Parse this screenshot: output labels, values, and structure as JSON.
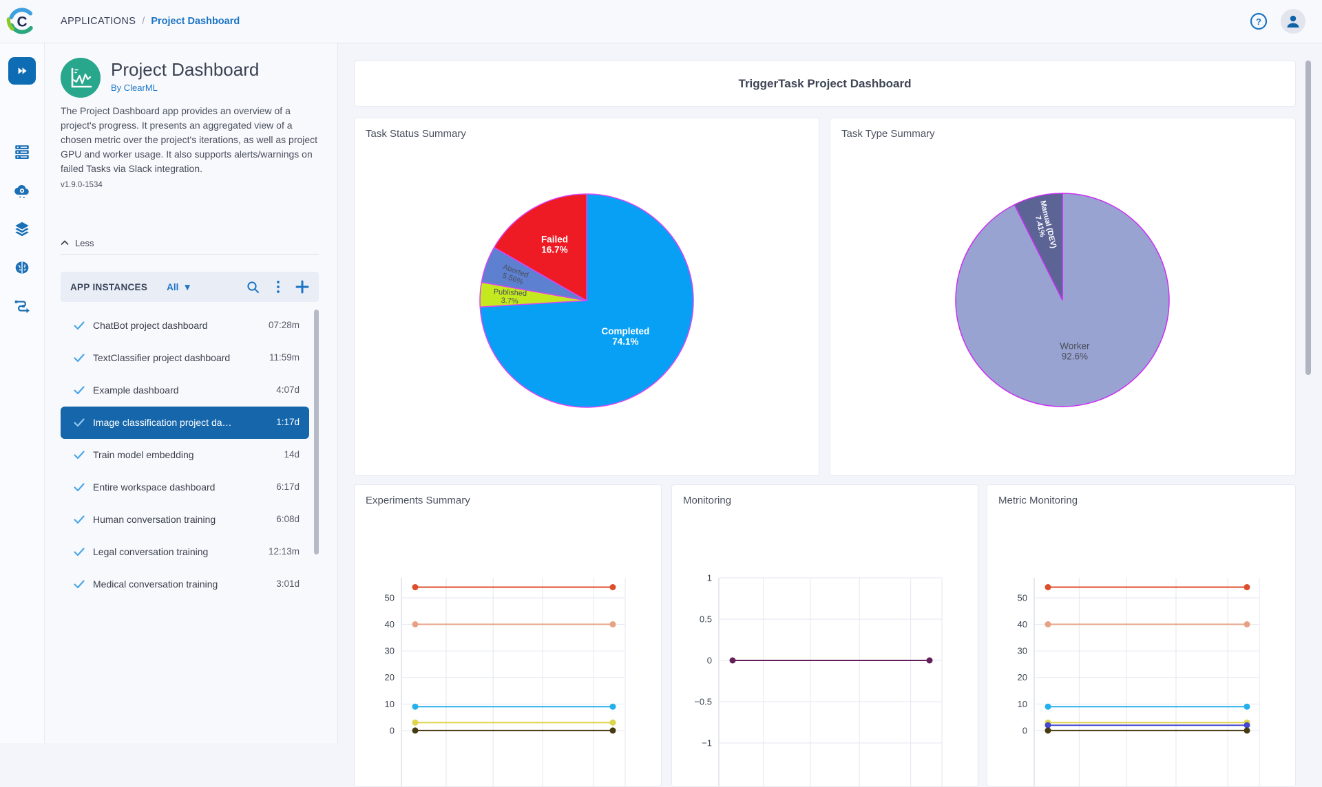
{
  "topbar": {
    "breadcrumb_root": "APPLICATIONS",
    "breadcrumb_separator": "/",
    "breadcrumb_current": "Project Dashboard",
    "help_glyph": "?"
  },
  "rail": {
    "items": [
      "applications",
      "workers-queues",
      "cloud-autoscalers",
      "datasets",
      "models",
      "pipelines"
    ],
    "accent_color": "#1a6fb5",
    "active_tile_color": "#0e6cb4"
  },
  "app_panel": {
    "title": "Project Dashboard",
    "byline": "By ClearML",
    "description": "The Project Dashboard app provides an overview of a project's progress. It presents an aggregated view of a chosen metric over the project's iterations, as well as project GPU and worker usage. It also supports alerts/warnings on failed Tasks via Slack integration.",
    "version": "v1.9.0-1534",
    "less_label": "Less",
    "instances": {
      "header": "APP INSTANCES",
      "filter": "All",
      "items": [
        {
          "name": "ChatBot project dashboard",
          "time": "07:28m",
          "selected": false
        },
        {
          "name": "TextClassifier project dashboard",
          "time": "11:59m",
          "selected": false
        },
        {
          "name": "Example dashboard",
          "time": "4:07d",
          "selected": false
        },
        {
          "name": "Image classification project da…",
          "time": "1:17d",
          "selected": true
        },
        {
          "name": "Train model embedding",
          "time": "14d",
          "selected": false
        },
        {
          "name": "Entire workspace dashboard",
          "time": "6:17d",
          "selected": false
        },
        {
          "name": "Human conversation training",
          "time": "6:08d",
          "selected": false
        },
        {
          "name": "Legal conversation training",
          "time": "12:13m",
          "selected": false
        },
        {
          "name": "Medical conversation training",
          "time": "3:01d",
          "selected": false
        }
      ],
      "selected_row_color": "#1566ab"
    }
  },
  "main": {
    "banner_title": "TriggerTask Project Dashboard"
  },
  "chart_data": [
    {
      "id": "task-status",
      "type": "pie",
      "title": "Task Status Summary",
      "stroke": "#d946f5",
      "slices": [
        {
          "label": "Completed",
          "value": 74.1,
          "pct": "74.1%",
          "color": "#08a0f5",
          "text_color": "#ffffff"
        },
        {
          "label": "Published",
          "value": 3.7,
          "pct": "3.7%",
          "color": "#c4e91e",
          "text_color": "#4a4f5a"
        },
        {
          "label": "Aborted",
          "value": 5.56,
          "pct": "5.56%",
          "color": "#5d80d1",
          "text_color": "#4a4f5a"
        },
        {
          "label": "Failed",
          "value": 16.7,
          "pct": "16.7%",
          "color": "#ee1b24",
          "text_color": "#ffffff"
        }
      ]
    },
    {
      "id": "task-type",
      "type": "pie",
      "title": "Task Type Summary",
      "stroke": "#c92ff2",
      "slices": [
        {
          "label": "Worker",
          "value": 92.6,
          "pct": "92.6%",
          "color": "#99a3d2",
          "text_color": "#4a4f5a"
        },
        {
          "label": "Manual (DEV)",
          "value": 7.41,
          "pct": "7.41%",
          "color": "#5c6496",
          "text_color": "#ffffff"
        }
      ]
    },
    {
      "id": "experiments-summary",
      "type": "line",
      "title": "Experiments Summary",
      "ylim": [
        -28,
        57.5
      ],
      "grid": true,
      "yticks": [
        {
          "v": 0,
          "label": "0"
        },
        {
          "v": 10,
          "label": "10"
        },
        {
          "v": 20,
          "label": "20"
        },
        {
          "v": 30,
          "label": "30"
        },
        {
          "v": 40,
          "label": "40"
        },
        {
          "v": 50,
          "label": "50"
        }
      ],
      "series": [
        {
          "name": "line-54",
          "y": 54,
          "color": "#dd4f2b"
        },
        {
          "name": "line-40",
          "y": 40,
          "color": "#e8a185"
        },
        {
          "name": "line-9",
          "y": 9,
          "color": "#25b0ed"
        },
        {
          "name": "line-3",
          "y": 3,
          "color": "#dfd44d"
        },
        {
          "name": "line-0",
          "y": 0,
          "color": "#453a12"
        }
      ]
    },
    {
      "id": "monitoring",
      "type": "line",
      "title": "Monitoring",
      "ylim": [
        -1.75,
        1
      ],
      "grid": true,
      "yticks": [
        {
          "v": 1,
          "label": "1"
        },
        {
          "v": 0.5,
          "label": "0.5"
        },
        {
          "v": 0,
          "label": "0"
        },
        {
          "v": -0.5,
          "label": "−0.5"
        },
        {
          "v": -1,
          "label": "−1"
        }
      ],
      "series": [
        {
          "name": "line-0",
          "y": 0,
          "color": "#632058"
        }
      ]
    },
    {
      "id": "metric-monitoring",
      "type": "line",
      "title": "Metric Monitoring",
      "ylim": [
        -28,
        57.5
      ],
      "grid": true,
      "yticks": [
        {
          "v": 0,
          "label": "0"
        },
        {
          "v": 10,
          "label": "10"
        },
        {
          "v": 20,
          "label": "20"
        },
        {
          "v": 30,
          "label": "30"
        },
        {
          "v": 40,
          "label": "40"
        },
        {
          "v": 50,
          "label": "50"
        }
      ],
      "series": [
        {
          "name": "line-54",
          "y": 54,
          "color": "#dd4f2b"
        },
        {
          "name": "line-40",
          "y": 40,
          "color": "#e8a185"
        },
        {
          "name": "line-9",
          "y": 9,
          "color": "#25b0ed"
        },
        {
          "name": "line-3",
          "y": 3,
          "color": "#dfd44d"
        },
        {
          "name": "line-2",
          "y": 2,
          "color": "#4648d0"
        },
        {
          "name": "line-0",
          "y": 0,
          "color": "#453a12"
        }
      ]
    }
  ]
}
